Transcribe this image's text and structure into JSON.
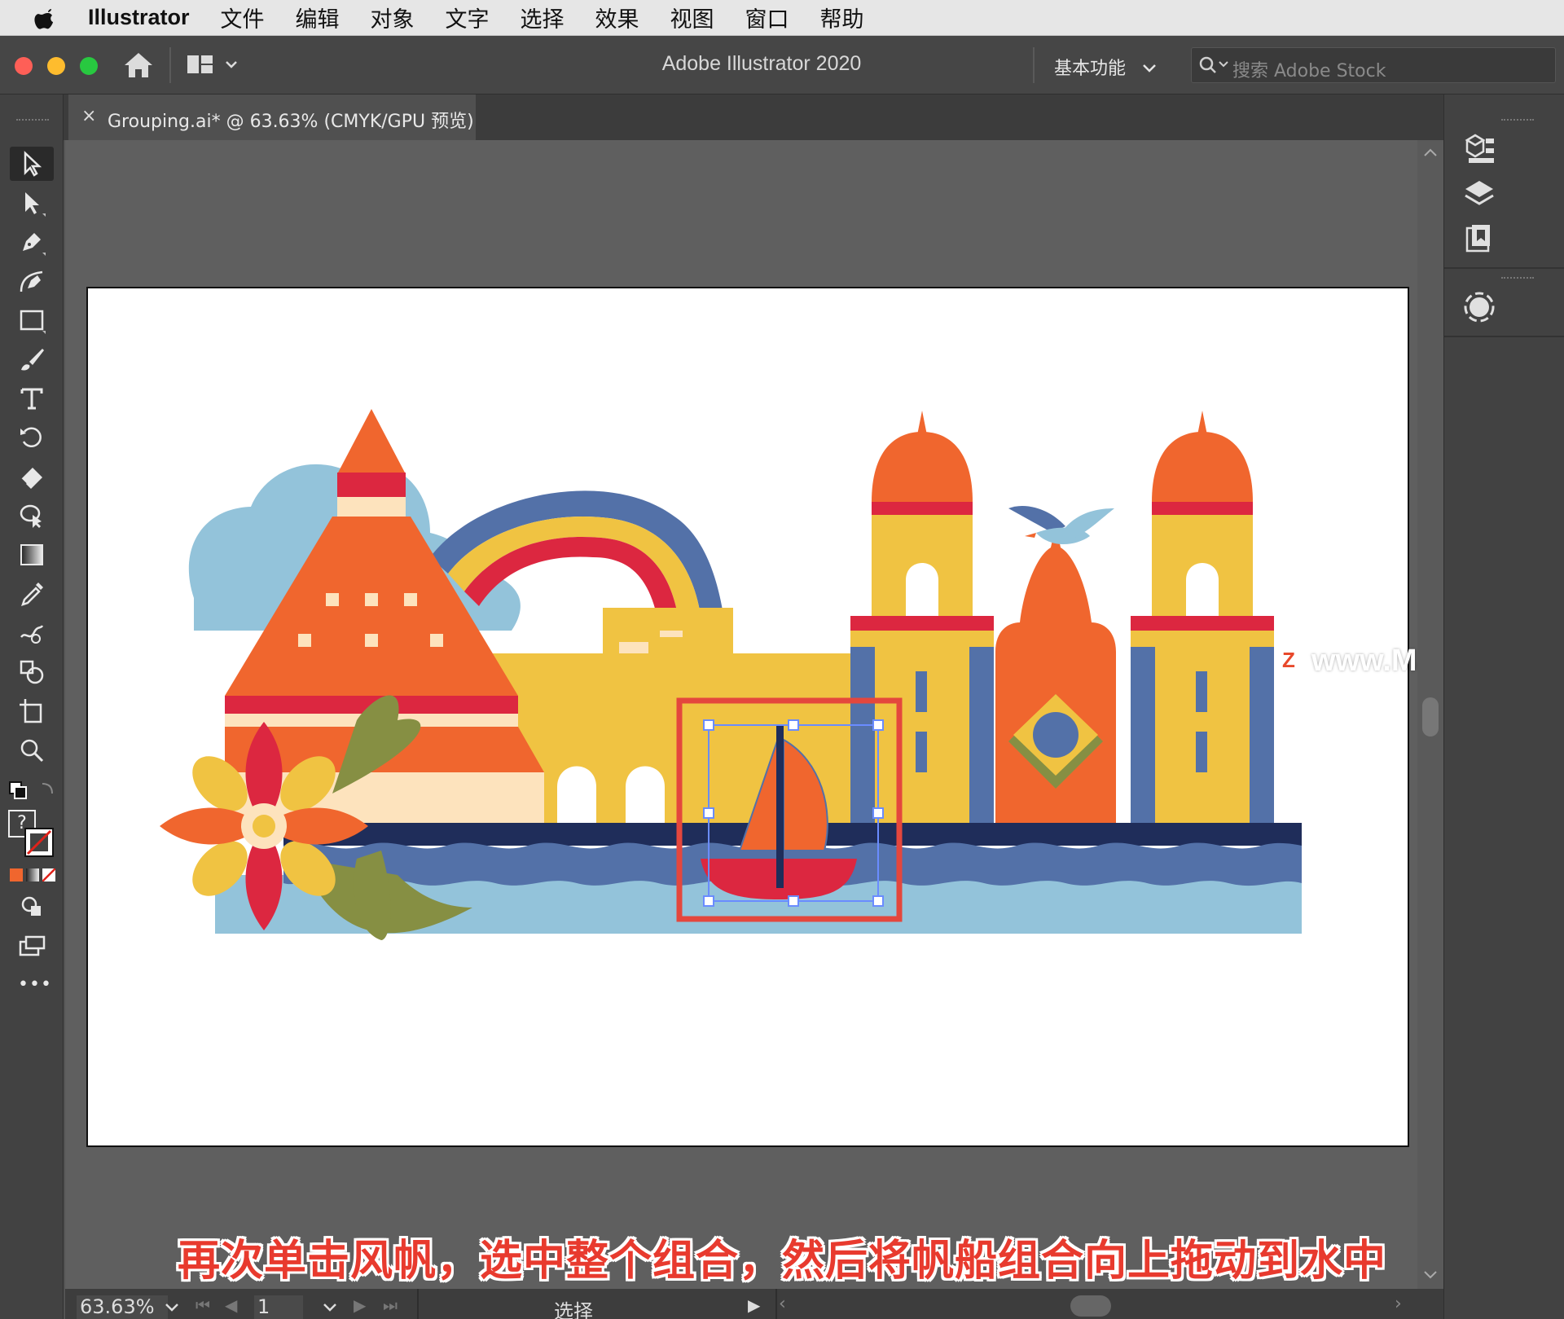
{
  "menubar": {
    "app_name": "Illustrator",
    "items": [
      "文件",
      "编辑",
      "对象",
      "文字",
      "选择",
      "效果",
      "视图",
      "窗口",
      "帮助"
    ]
  },
  "titlebar": {
    "title": "Adobe Illustrator 2020",
    "workspace": "基本功能",
    "search_placeholder": "搜索 Adobe Stock"
  },
  "document_tab": {
    "label": "Grouping.ai* @ 63.63% (CMYK/GPU 预览)"
  },
  "toolbar": {
    "tools": [
      "selection-tool",
      "direct-selection-tool",
      "pen-tool",
      "curvature-tool",
      "rectangle-tool",
      "paintbrush-tool",
      "type-tool",
      "rotate-tool",
      "eraser-tool",
      "puppet-warp-tool",
      "gradient-tool",
      "eyedropper-tool",
      "blend-tool",
      "shape-builder-tool",
      "artboard-tool",
      "zoom-tool"
    ],
    "more_label": "•••"
  },
  "status_bar": {
    "zoom": "63.63%",
    "artboard_number": "1",
    "current_tool": "选择"
  },
  "subtitle": "再次单击风帆，选中整个组合，然后将帆船组合向上拖动到水中",
  "watermark": "www.MacZ.com",
  "colors": {
    "orange": "#f0662e",
    "red": "#dc2740",
    "yellow": "#f0c342",
    "blue": "#5371a8",
    "light_blue": "#93c3da",
    "navy": "#1f2d5a",
    "cream": "#fde3bd",
    "olive": "#868f43",
    "highlight": "#e4473d"
  }
}
